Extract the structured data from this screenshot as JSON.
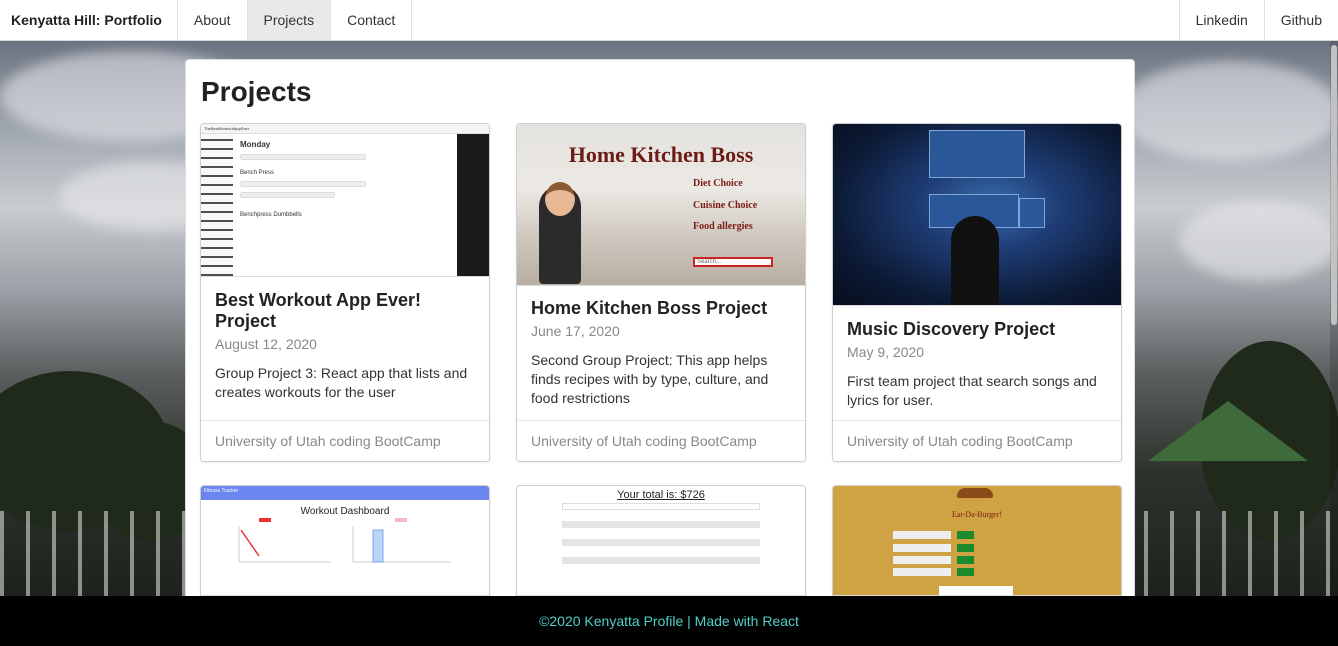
{
  "navbar": {
    "brand": "Kenyatta Hill: Portfolio",
    "links": [
      "About",
      "Projects",
      "Contact"
    ],
    "active": "Projects",
    "right_links": [
      "Linkedin",
      "Github"
    ]
  },
  "page": {
    "title": "Projects"
  },
  "cards": [
    {
      "title": "Best Workout App Ever! Project",
      "date": "August 12, 2020",
      "text": "Group Project 3: React app that lists and creates workouts for the user",
      "footer": "University of Utah coding BootCamp",
      "thumb": {
        "app_name": "TheBestWorkoutAppEver",
        "day": "Monday",
        "ex1": "Bench Press",
        "ex2": "Benchpress Dumbbells"
      }
    },
    {
      "title": "Home Kitchen Boss Project",
      "date": "June 17, 2020",
      "text": "Second Group Project: This app helps finds recipes with by type, culture, and food restrictions",
      "footer": "University of Utah coding BootCamp",
      "thumb": {
        "heading": "Home Kitchen Boss",
        "opt1": "Diet Choice",
        "opt2": "Cuisine Choice",
        "opt3": "Food allergies",
        "search": "Search..."
      }
    },
    {
      "title": "Music Discovery Project",
      "date": "May 9, 2020",
      "text": "First team project that search songs and lyrics for user.",
      "footer": "University of Utah coding BootCamp"
    }
  ],
  "thumbs_row2": {
    "dash": {
      "bar": "Fitness Tracker",
      "heading": "Workout Dashboard"
    },
    "budget": {
      "total": "Your total is: $726"
    },
    "burger": {
      "heading": "Eat-Da-Burger!"
    }
  },
  "footer": {
    "text": "©2020 Kenyatta Profile | Made with React",
    "color": "#4fd1c5"
  }
}
